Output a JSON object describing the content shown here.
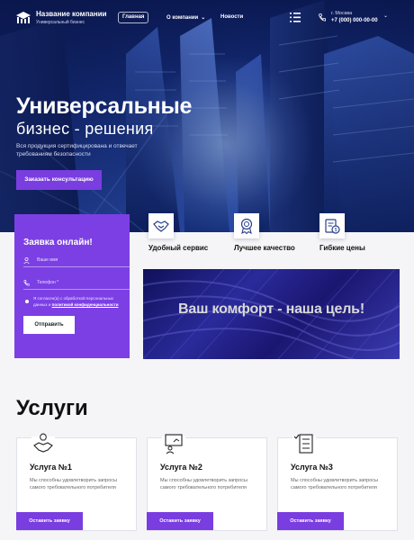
{
  "header": {
    "company_name": "Название компании",
    "company_tagline": "Универсальный бизнес",
    "nav": [
      {
        "label": "Главная"
      },
      {
        "label": "О компании"
      },
      {
        "label": "Новости"
      }
    ],
    "city": "г. Москва",
    "phone": "+7 (000) 000-00-00",
    "icons": [
      "logo-icon",
      "menu-icon",
      "phone-icon",
      "chevron-down-icon"
    ]
  },
  "hero": {
    "title": "Универсальные",
    "subtitle": "бизнес - решения",
    "description": "Вся продукция сертифицирована и отвечает требованиям безопасности",
    "cta_label": "Заказать консультацию"
  },
  "form": {
    "title": "Заявка онлайн!",
    "name_placeholder": "Ваше имя",
    "phone_placeholder": "Телефон *",
    "consent_text": "Я согласен(а) с обработкой персональных данных и ",
    "consent_link": "политикой конфиденциальности",
    "submit_label": "Отправить"
  },
  "features": [
    {
      "label": "Удобный сервис",
      "icon": "handshake-icon"
    },
    {
      "label": "Лучшее качество",
      "icon": "award-medal-icon"
    },
    {
      "label": "Гибкие цены",
      "icon": "price-tag-icon"
    }
  ],
  "banner": {
    "text": "Ваш комфорт - наша цель!"
  },
  "services": {
    "title": "Услуги",
    "items": [
      {
        "title": "Услуга №1",
        "desc": "Мы способны удовлетворить запросы самого требовательного потребителя",
        "button": "Оставить заявку",
        "icon": "handshake-idea-icon"
      },
      {
        "title": "Услуга №2",
        "desc": "Мы способны удовлетворить запросы самого требовательного потребителя",
        "button": "Оставить заявку",
        "icon": "presentation-board-icon"
      },
      {
        "title": "Услуга №3",
        "desc": "Мы способны удовлетворить запросы самого требовательного потребителя",
        "button": "Оставить заявку",
        "icon": "checklist-icon"
      }
    ]
  },
  "colors": {
    "accent": "#7a3de0",
    "hero_dark": "#0b1a55",
    "banner": "#1a1670"
  }
}
